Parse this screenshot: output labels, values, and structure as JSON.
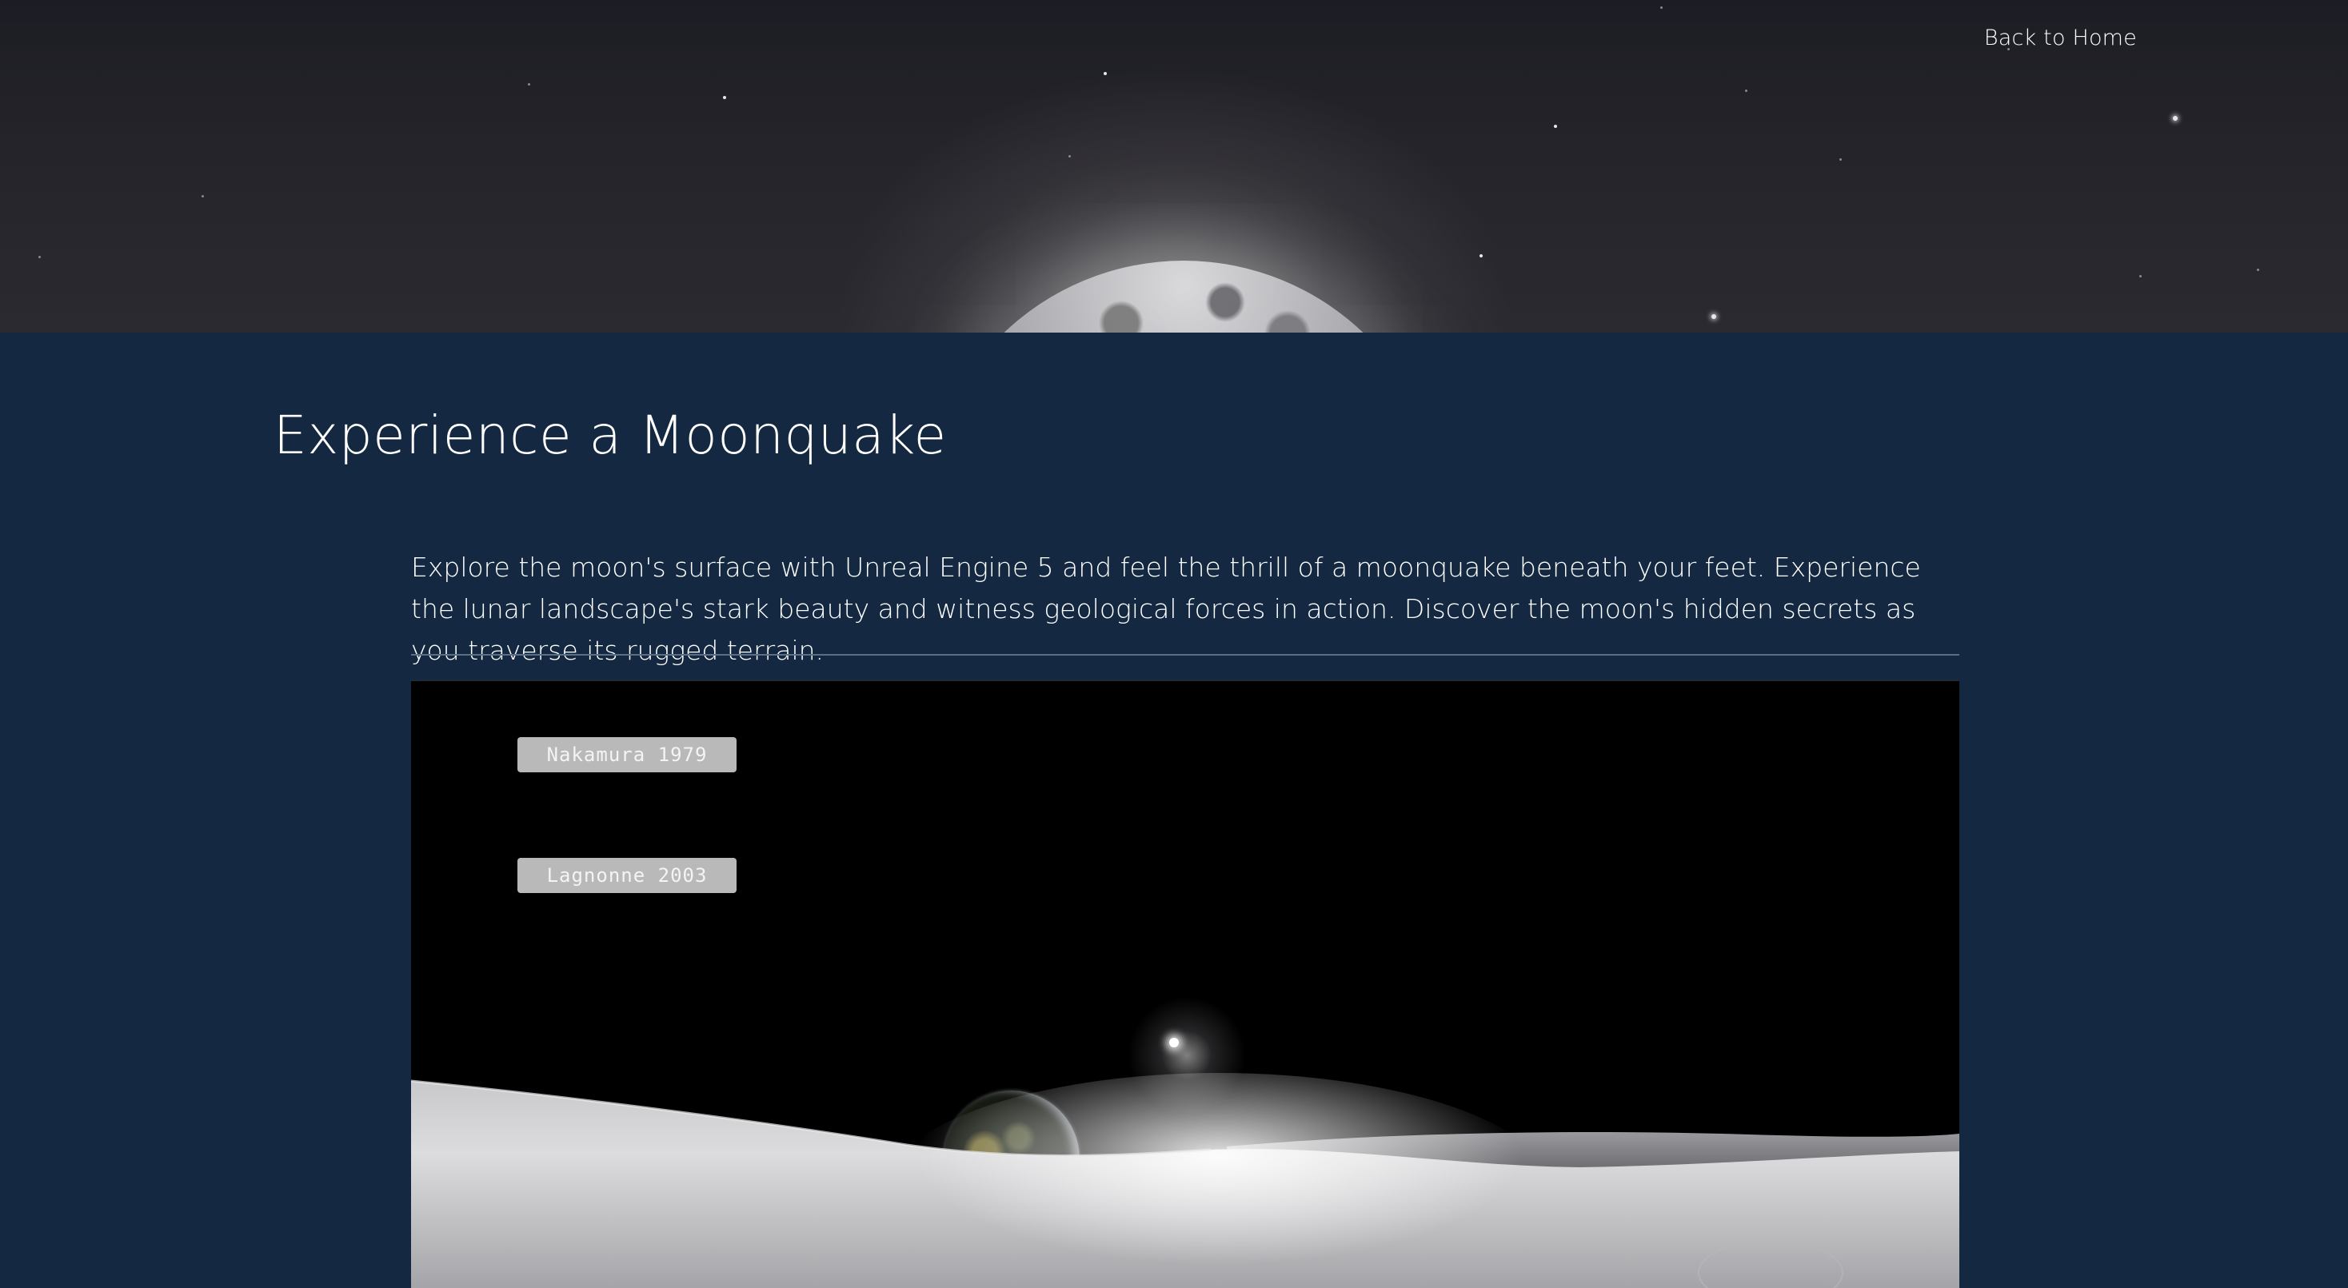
{
  "header": {
    "back_link": "Back to Home"
  },
  "main": {
    "title": "Experience a Moonquake",
    "description": "Explore the moon's surface with Unreal Engine 5 and feel the thrill of a moonquake beneath your feet. Experience the lunar landscape's stark beauty and witness geological forces in action. Discover the moon's hidden secrets as you traverse its rugged terrain."
  },
  "viewport": {
    "buttons": [
      {
        "label": "Nakamura 1979"
      },
      {
        "label": "Lagnonne 2003"
      }
    ]
  },
  "colors": {
    "page_background": "#142941",
    "viewport_background": "#000000",
    "scene_button_background": "#b9b9b9",
    "text": "#ffffff"
  }
}
